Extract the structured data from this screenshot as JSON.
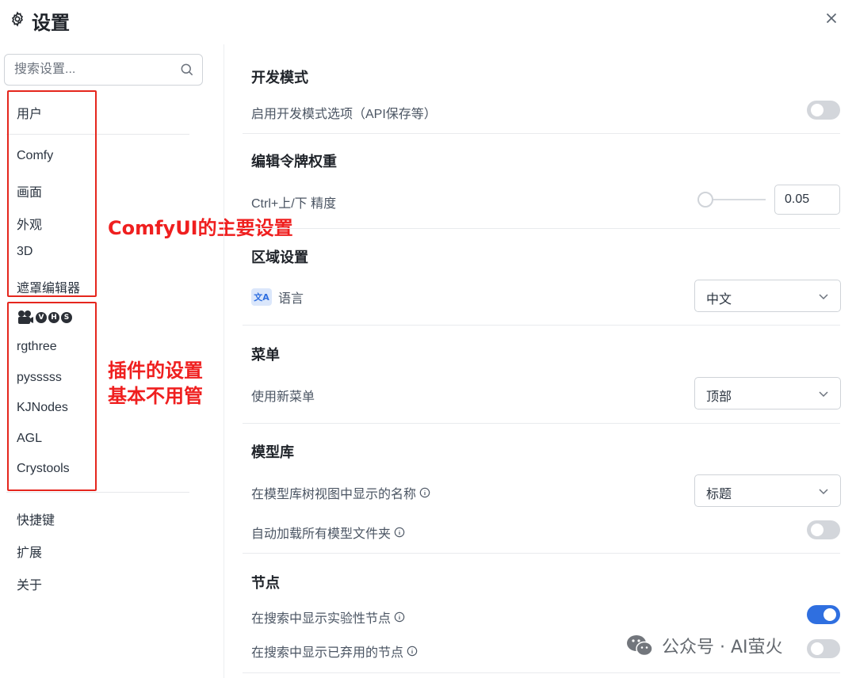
{
  "header": {
    "title": "设置",
    "icon": "gear-icon",
    "close_icon": "close-icon"
  },
  "search": {
    "placeholder": "搜索设置..."
  },
  "sidebar": {
    "group1": [
      "用户"
    ],
    "group2": [
      "Comfy",
      "画面",
      "外观",
      "3D",
      "遮罩编辑器"
    ],
    "vhs_label": [
      "V",
      "H",
      "S"
    ],
    "group3": [
      "rgthree",
      "pysssss",
      "KJNodes",
      "AGL",
      "Crystools"
    ],
    "group4": [
      "快捷键",
      "扩展",
      "关于"
    ]
  },
  "annotations": {
    "main": "ComfyUI的主要设置",
    "plugins_line1": "插件的设置",
    "plugins_line2": "基本不用管"
  },
  "sections": {
    "dev": {
      "title": "开发模式",
      "label": "启用开发模式选项（API保存等）",
      "enabled": false
    },
    "token": {
      "title": "编辑令牌权重",
      "label": "Ctrl+上/下 精度",
      "value": "0.05"
    },
    "locale": {
      "title": "区域设置",
      "label": "语言",
      "icon_text": "文A",
      "value": "中文"
    },
    "menu": {
      "title": "菜单",
      "label": "使用新菜单",
      "value": "顶部"
    },
    "model_lib": {
      "title": "模型库",
      "name_label": "在模型库树视图中显示的名称",
      "name_value": "标题",
      "autoload_label": "自动加载所有模型文件夹",
      "autoload_enabled": false
    },
    "node": {
      "title": "节点",
      "experimental_label": "在搜索中显示实验性节点",
      "experimental_enabled": true,
      "deprecated_label": "在搜索中显示已弃用的节点",
      "deprecated_enabled": false
    }
  },
  "watermark": {
    "text": "公众号 · AI萤火"
  },
  "colors": {
    "accent": "#2f6fe0",
    "annotation": "#ef1f1f"
  }
}
